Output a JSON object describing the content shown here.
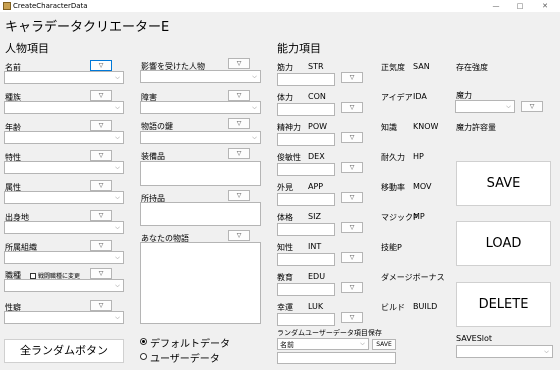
{
  "window": {
    "title": "CreateCharacterData",
    "minimize": "—",
    "maximize": "□",
    "close": "✕"
  },
  "heading": {
    "app": "キャラデータクリエーターE",
    "person": "人物項目",
    "ability": "能力項目"
  },
  "person_fields": [
    {
      "label": "名前"
    },
    {
      "label": "種族"
    },
    {
      "label": "年齢"
    },
    {
      "label": "特性"
    },
    {
      "label": "属性"
    },
    {
      "label": "出身地"
    },
    {
      "label": "所属組織"
    },
    {
      "label": "職種"
    },
    {
      "label": "性癖"
    }
  ],
  "job_checkbox": "戦闘職種に変更",
  "mid_fields": {
    "influenced": "影響を受けた人物",
    "obstacle": "障害",
    "key": "物語の鍵",
    "equipment": "装備品",
    "possession": "所持品",
    "story": "あなたの物語"
  },
  "vbtn": "▽",
  "stats": [
    {
      "jp": "筋力",
      "en": "STR"
    },
    {
      "jp": "体力",
      "en": "CON"
    },
    {
      "jp": "精神力",
      "en": "POW"
    },
    {
      "jp": "俊敏性",
      "en": "DEX"
    },
    {
      "jp": "外見",
      "en": "APP"
    },
    {
      "jp": "体格",
      "en": "SIZ"
    },
    {
      "jp": "知性",
      "en": "INT"
    },
    {
      "jp": "教育",
      "en": "EDU"
    },
    {
      "jp": "幸運",
      "en": "LUK"
    }
  ],
  "derived": [
    {
      "jp": "正気度",
      "en": "SAN"
    },
    {
      "jp": "アイデア",
      "en": "IDA"
    },
    {
      "jp": "知識",
      "en": "KNOW"
    },
    {
      "jp": "耐久力",
      "en": "HP"
    },
    {
      "jp": "移動率",
      "en": "MOV"
    },
    {
      "jp": "マジックP",
      "en": "MP"
    },
    {
      "jp": "技能P",
      "en": ""
    },
    {
      "jp": "ダメージボーナス",
      "en": ""
    },
    {
      "jp": "ビルド",
      "en": "BUILD"
    }
  ],
  "right": {
    "existence": "存在強度",
    "magic": "魔力",
    "magic_allow": "魔力許容量",
    "save": "SAVE",
    "load": "LOAD",
    "delete": "DELETE",
    "saveslot": "SAVESlot"
  },
  "random_btn": "全ランダムボタン",
  "radio": {
    "default": "デフォルトデータ",
    "user": "ユーザーデータ"
  },
  "random_save": {
    "label": "ランダムユーザーデータ項目保存",
    "select": "名前",
    "save": "SAVE"
  }
}
